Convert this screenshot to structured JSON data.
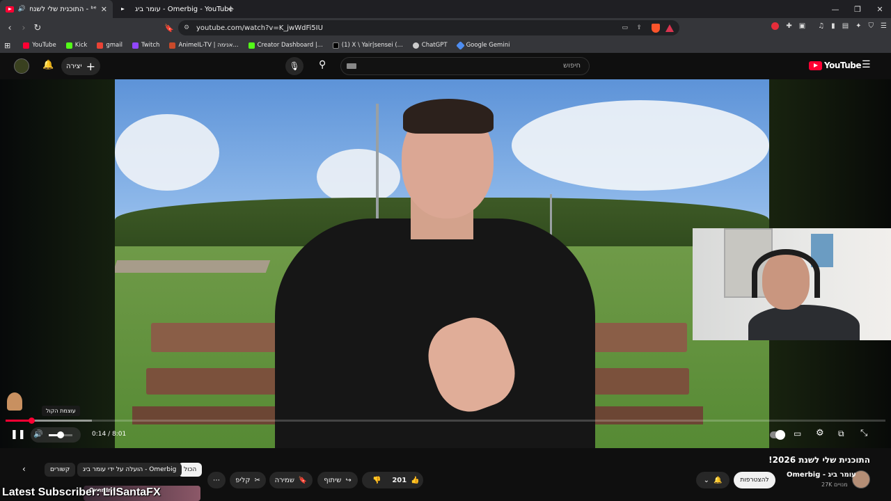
{
  "tabs": [
    {
      "title": "ᵇᵉ - התוכנית שלי לשנת 2026!",
      "active": true
    },
    {
      "title": "עומר ביג - Omerbig - YouTube",
      "active": false
    }
  ],
  "address": "youtube.com/watch?v=K_jwWdFi5IU",
  "bookmarks": [
    "YouTube",
    "Kick",
    "gmail",
    "Twitch",
    "AnimeIL-TV | אנימה...",
    "Creator Dashboard |...",
    "(1) X \\ Yair|sensei (...",
    "ChatGPT",
    "Google Gemini"
  ],
  "yt": {
    "logo": "YouTube",
    "create_label": "יצירה",
    "search_placeholder": "חיפוש"
  },
  "player": {
    "volume_tooltip": "עוצמת הקול",
    "time": "0:14 / 8:01",
    "progress_fraction": 0.029,
    "volume_fraction": 0.5
  },
  "video": {
    "title": "התוכנית שלי לשנת 2026!",
    "channel": "Omerbig - עומר ביג",
    "subscribers": "27K מנויים",
    "join_label": "להצטרפות",
    "likes": "201",
    "share_label": "שיתוף",
    "save_label": "שמירה",
    "clip_label": "קליפ"
  },
  "chips": [
    "הכול",
    "הועלה על ידי עומר ביג - Omerbig",
    "קשורים"
  ],
  "overlay": {
    "latest_subscriber": "Latest Subscriber: LilSantaFX",
    "thumb_label": "Overdrive"
  },
  "colors": {
    "accent": "#ff0033",
    "bg": "#0f0f0f",
    "chip": "#272727"
  }
}
